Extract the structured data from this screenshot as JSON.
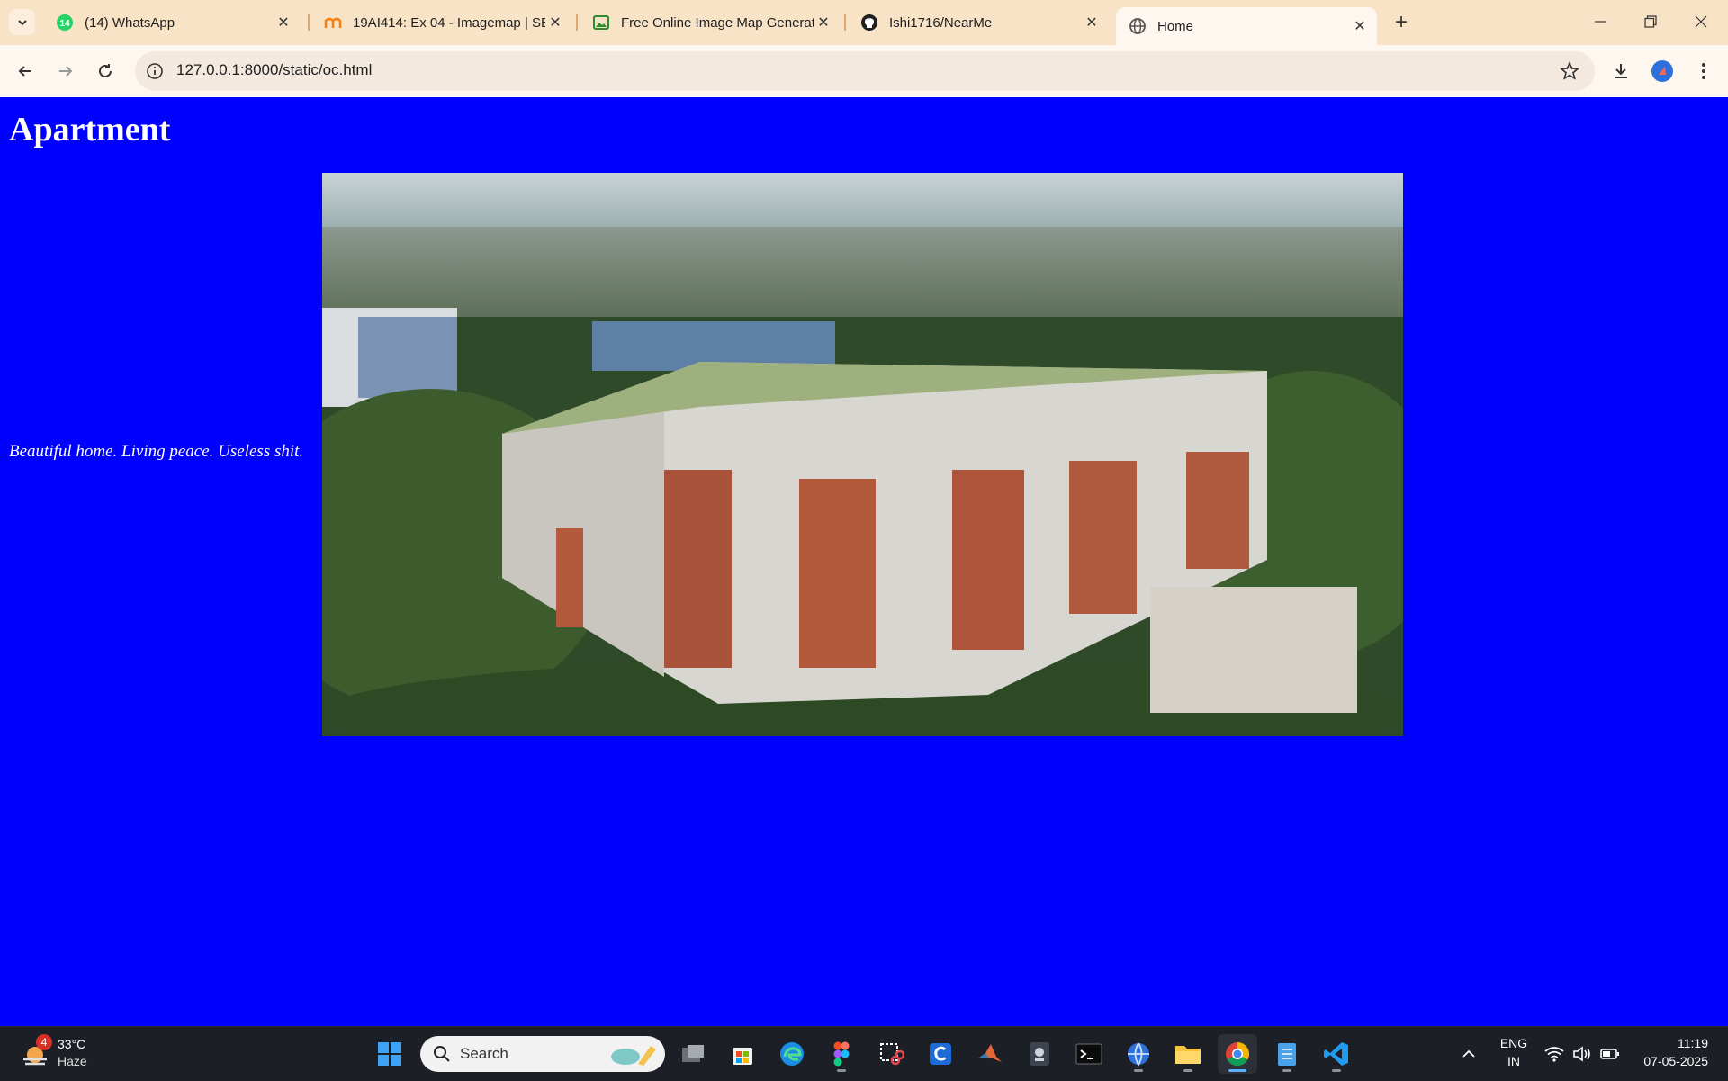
{
  "browser": {
    "tabs": [
      {
        "title": "(14) WhatsApp",
        "favicon": "whatsapp-icon",
        "badge": "14"
      },
      {
        "title": "19AI414: Ex 04 - Imagemap | SE",
        "favicon": "moodle-icon"
      },
      {
        "title": "Free Online Image Map Generat",
        "favicon": "image-icon"
      },
      {
        "title": "Ishi1716/NearMe",
        "favicon": "github-icon"
      },
      {
        "title": "Home",
        "favicon": "globe-icon",
        "active": true
      }
    ],
    "url": "127.0.0.1:8000/static/oc.html"
  },
  "page": {
    "heading": "Apartment",
    "tagline": "Beautiful home. Living peace. Useless shit.",
    "background_color": "#0000ff",
    "image_alt": "apartment-building-photo"
  },
  "taskbar": {
    "weather": {
      "temp": "33°C",
      "condition": "Haze",
      "badge": "4"
    },
    "search_placeholder": "Search",
    "apps": [
      "windows-start-icon",
      "task-view-icon",
      "store-icon",
      "edge-icon",
      "figma-icon",
      "snipping-tool-icon",
      "app-c-icon",
      "matlab-icon",
      "app-icon",
      "terminal-icon",
      "network-app-icon",
      "file-explorer-icon",
      "chrome-icon",
      "notepad-icon",
      "vscode-icon"
    ],
    "language": {
      "line1": "ENG",
      "line2": "IN"
    },
    "clock": {
      "time": "11:19",
      "date": "07-05-2025"
    }
  }
}
